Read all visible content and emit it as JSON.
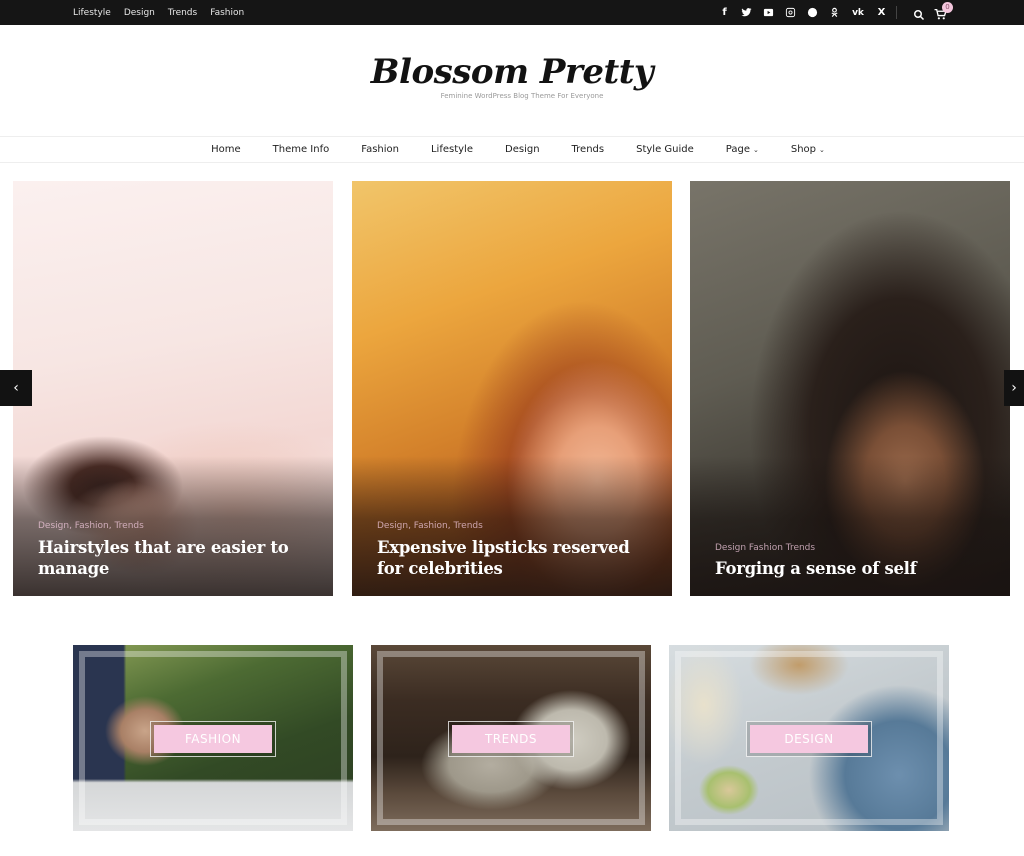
{
  "topbar": {
    "links": [
      "Lifestyle",
      "Design",
      "Trends",
      "Fashion"
    ],
    "social_icons": [
      "facebook-icon",
      "twitter-icon",
      "youtube-icon",
      "instagram-icon",
      "dribbble-icon",
      "odnoklassniki-icon",
      "vk-icon",
      "xing-icon"
    ],
    "cart_count": "0"
  },
  "header": {
    "site_title": "Blossom Pretty",
    "tagline": "Feminine WordPress Blog Theme For Everyone"
  },
  "nav": {
    "items": [
      {
        "label": "Home",
        "has_dropdown": false
      },
      {
        "label": "Theme Info",
        "has_dropdown": false
      },
      {
        "label": "Fashion",
        "has_dropdown": false
      },
      {
        "label": "Lifestyle",
        "has_dropdown": false
      },
      {
        "label": "Design",
        "has_dropdown": false
      },
      {
        "label": "Trends",
        "has_dropdown": false
      },
      {
        "label": "Style Guide",
        "has_dropdown": false
      },
      {
        "label": "Page",
        "has_dropdown": true
      },
      {
        "label": "Shop",
        "has_dropdown": true
      }
    ],
    "dropdown_glyph": "⌄"
  },
  "slider": {
    "prev_glyph": "‹",
    "next_glyph": "›",
    "slides": [
      {
        "categories": "Design, Fashion, Trends",
        "title": "Hairstyles that are easier to manage"
      },
      {
        "categories": "Design, Fashion, Trends",
        "title": "Expensive lipsticks reserved for celebrities"
      },
      {
        "categories": "Design Fashion Trends",
        "title": "Forging a sense of self"
      }
    ]
  },
  "categories": {
    "tiles": [
      {
        "label": "FASHION"
      },
      {
        "label": "TRENDS"
      },
      {
        "label": "DESIGN"
      }
    ]
  },
  "colors": {
    "topbar_bg": "#151515",
    "accent_pink": "#f5c8e0"
  }
}
